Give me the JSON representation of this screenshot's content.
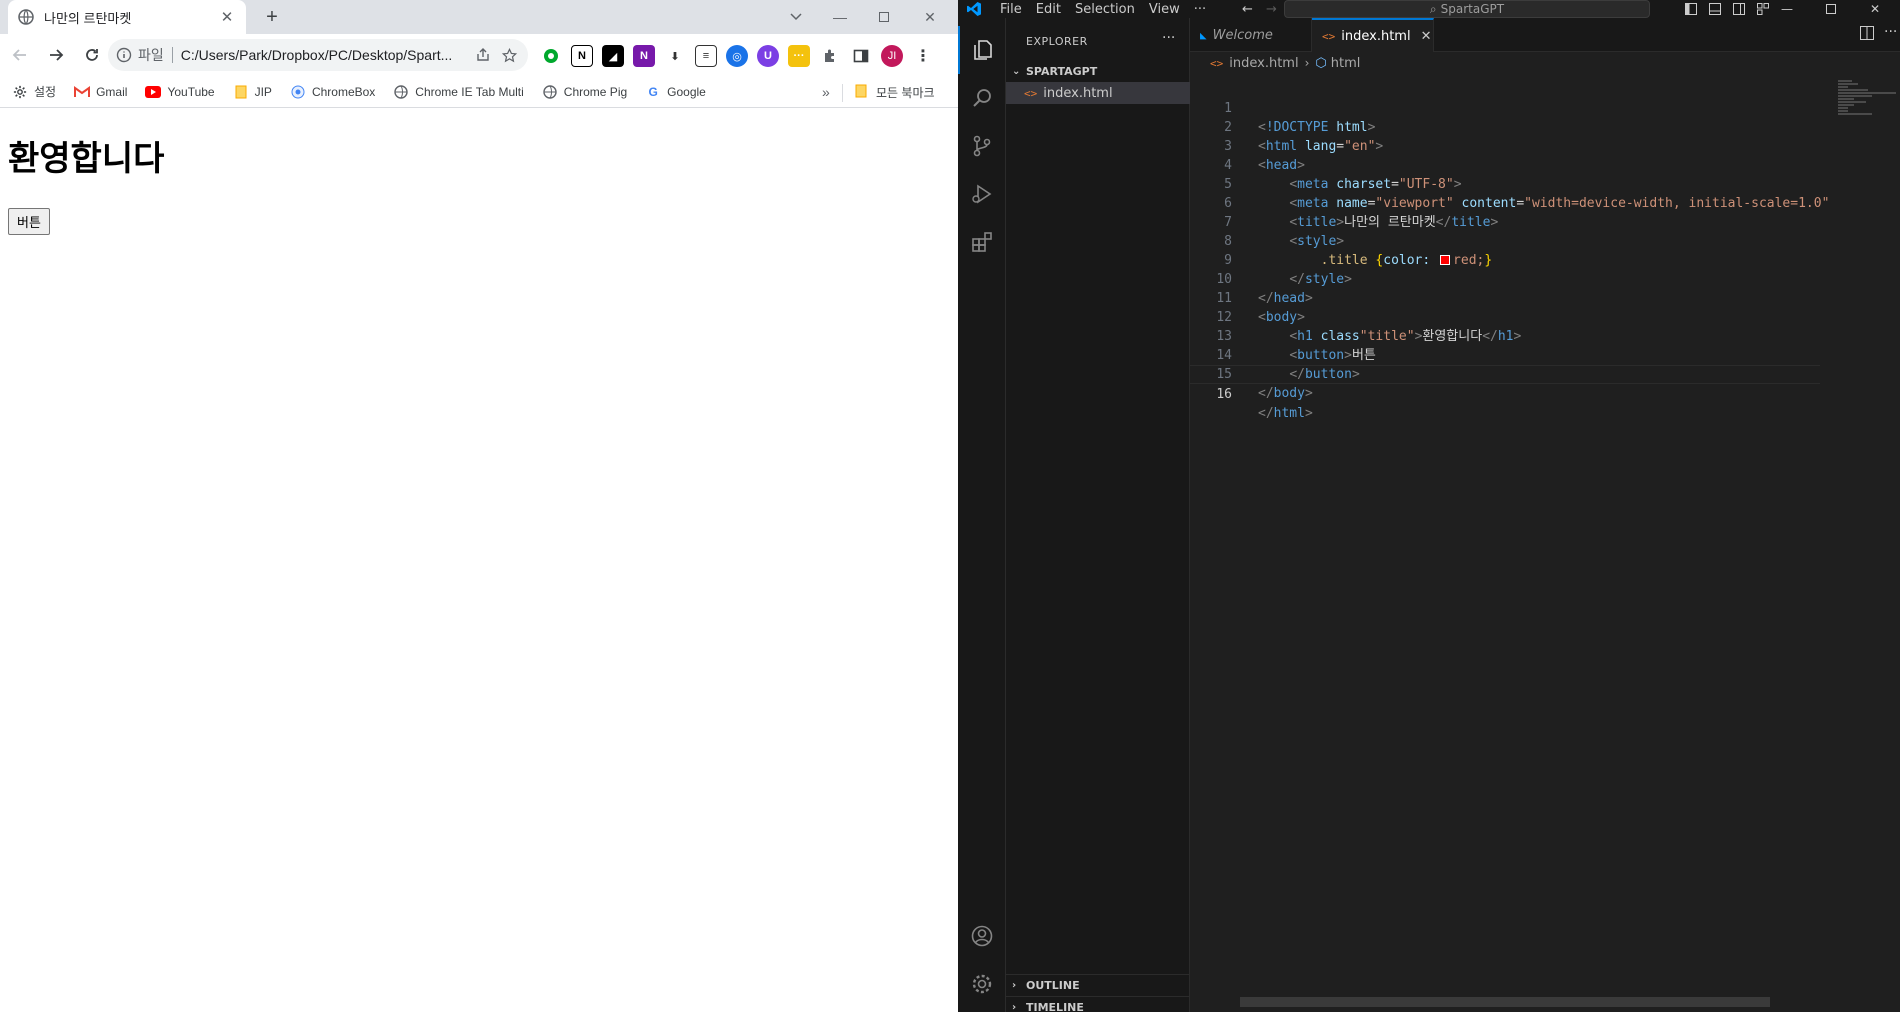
{
  "browser": {
    "tab_title": "나만의 르탄마켓",
    "new_tab_label": "+",
    "omnibox": {
      "scheme": "파일",
      "url": "C:/Users/Park/Dropbox/PC/Desktop/Spart..."
    },
    "profile_initials": "JI",
    "bookmarks": [
      {
        "label": "설정",
        "icon": "gear-icon"
      },
      {
        "label": "Gmail",
        "icon": "gmail-icon"
      },
      {
        "label": "YouTube",
        "icon": "youtube-icon"
      },
      {
        "label": "JIP",
        "icon": "folder-icon"
      },
      {
        "label": "ChromeBox",
        "icon": "globe-icon"
      },
      {
        "label": "Chrome IE Tab Multi",
        "icon": "globe-icon"
      },
      {
        "label": "Chrome Pig",
        "icon": "globe-icon"
      },
      {
        "label": "Google",
        "icon": "google-icon"
      }
    ],
    "bookmarks_more": "»",
    "all_bookmarks_label": "모든 북마크",
    "page": {
      "heading": "환영합니다",
      "button_label": "버튼"
    }
  },
  "vscode": {
    "menu": [
      "File",
      "Edit",
      "Selection",
      "View",
      "···"
    ],
    "search_text": "SpartaGPT",
    "sidebar": {
      "title": "EXPLORER",
      "more": "···",
      "folder": "SPARTAGPT",
      "file": "index.html",
      "outline": "OUTLINE",
      "timeline": "TIMELINE"
    },
    "tabs": {
      "welcome": "Welcome",
      "active": "index.html",
      "close": "✕"
    },
    "breadcrumb": {
      "file": "index.html",
      "symbol": "html"
    },
    "code": {
      "line_numbers": [
        "1",
        "2",
        "3",
        "4",
        "5",
        "6",
        "7",
        "8",
        "9",
        "10",
        "11",
        "12",
        "13",
        "14",
        "15",
        "16"
      ],
      "l1_tag": "!DOCTYPE",
      "l1_val": "html",
      "html": "html",
      "lang_attr": "lang",
      "lang_val": "\"en\"",
      "head": "head",
      "meta": "meta",
      "charset_attr": "charset",
      "charset_val": "\"UTF-8\"",
      "name_attr": "name",
      "name_val": "\"viewport\"",
      "content_attr": "content",
      "content_val": "\"width=device-width, initial-scale=1.0\"",
      "title_tag": "title",
      "title_text": "나만의 르탄마켓",
      "style_tag": "style",
      "css_selector": ".title",
      "css_open": "{",
      "css_prop": "color:",
      "css_val": "red;",
      "css_close": "}",
      "body": "body",
      "h1": "h1",
      "class_attr": "class",
      "class_val": "\"title\"",
      "h1_text": "환영합니다",
      "button_tag": "button",
      "button_text": "버튼"
    },
    "colors": {
      "accent": "#0078d4",
      "editor_bg": "#1f1f1f",
      "swatch": "#ff0000"
    }
  }
}
